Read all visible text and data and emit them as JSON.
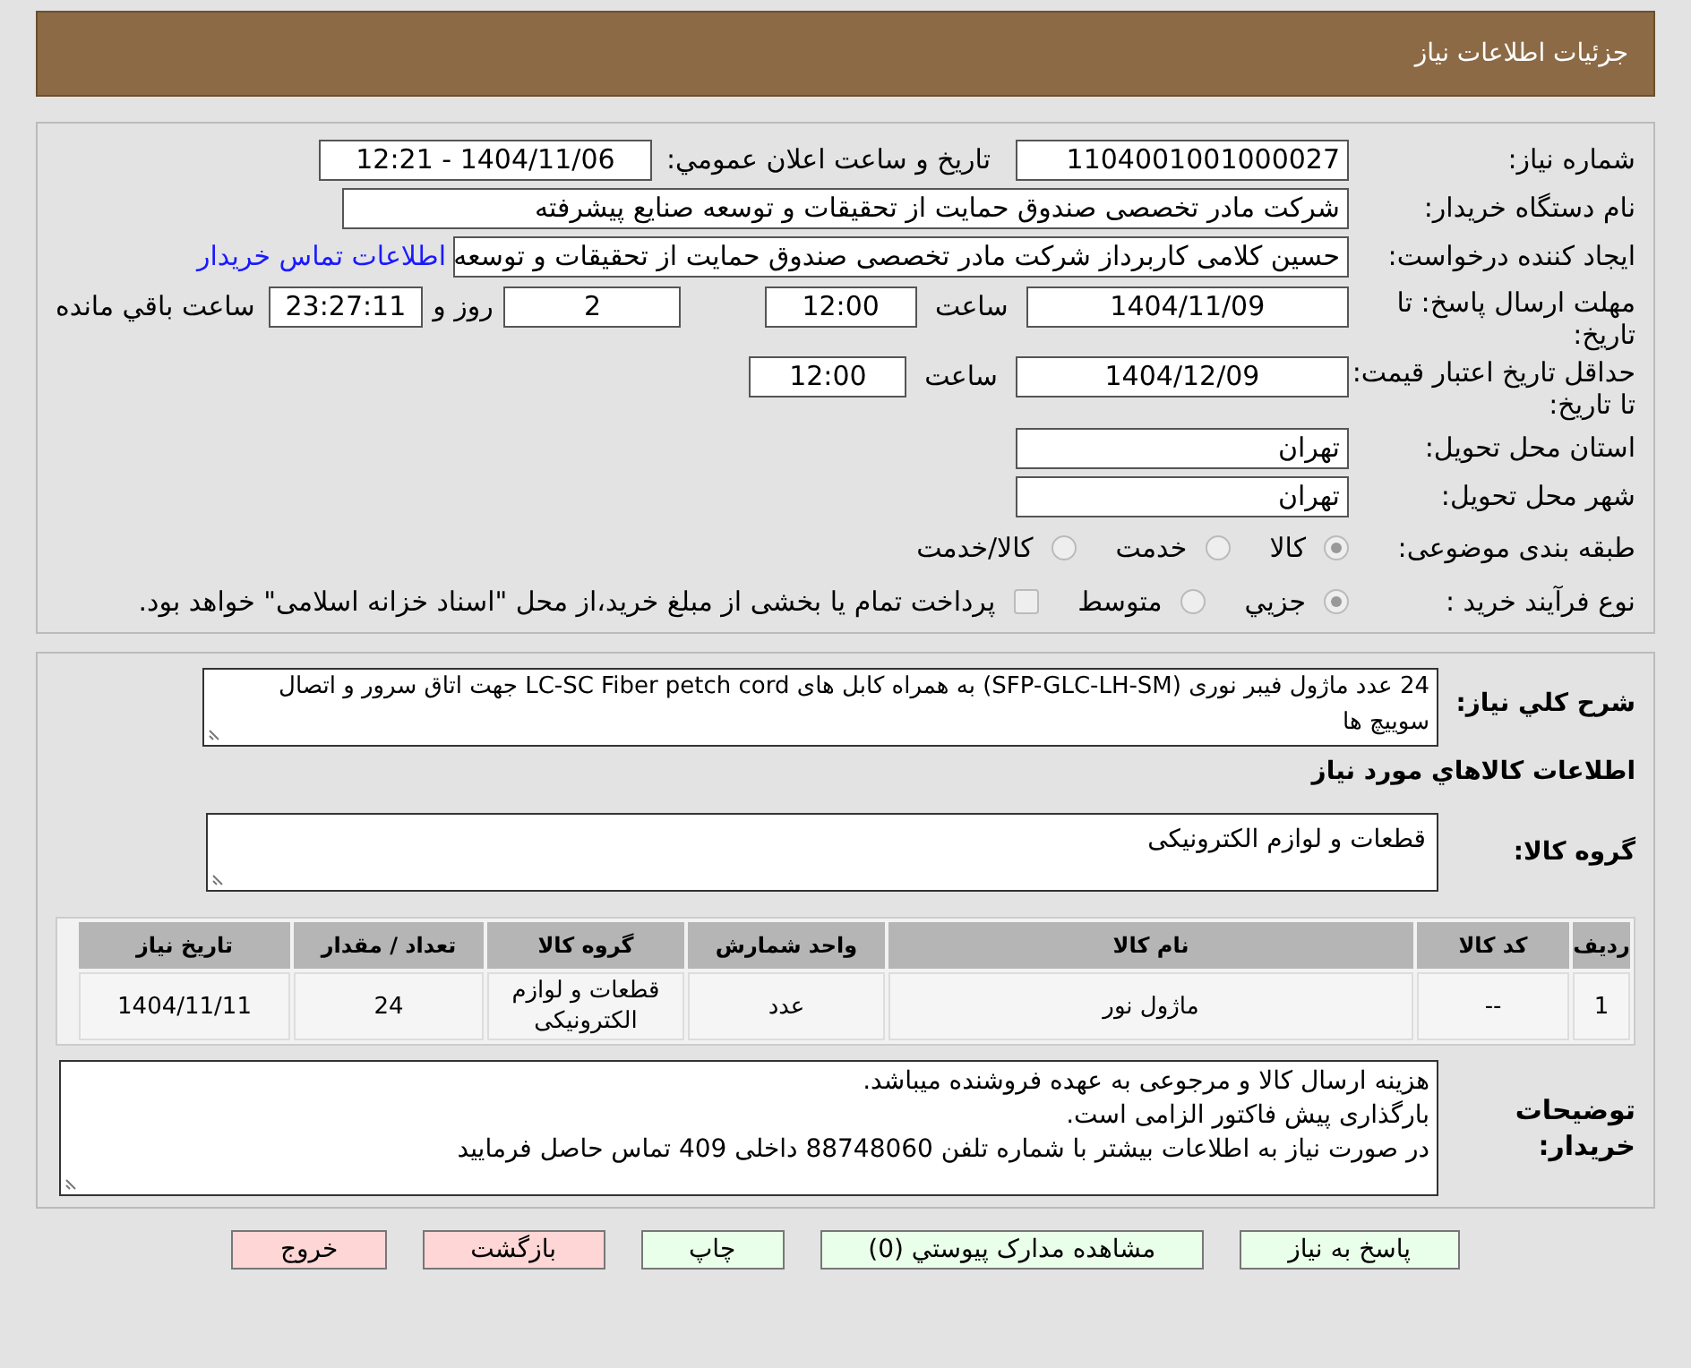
{
  "header": {
    "title": "جزئیات اطلاعات نیاز"
  },
  "need_number": {
    "label": "شماره نیاز:",
    "value": "1104001001000027"
  },
  "announce": {
    "label": "تاریخ و ساعت اعلان عمومي:",
    "value": "1404/11/06 - 12:21"
  },
  "buyer": {
    "label": "نام دستگاه خریدار:",
    "value": "شرکت مادر تخصصی صندوق حمایت از تحقیقات و توسعه صنایع پیشرفته"
  },
  "creator": {
    "label": "ایجاد کننده درخواست:",
    "value": "حسین کلامی کاربرداز شرکت مادر تخصصی صندوق حمایت از تحقیقات و توسعه",
    "link": "اطلاعات تماس خریدار"
  },
  "deadline": {
    "label": "مهلت ارسال پاسخ: تا تاریخ:",
    "date": "1404/11/09",
    "time_label": "ساعت",
    "time": "12:00",
    "days": "2",
    "days_label": "روز و",
    "remaining": "23:27:11",
    "remaining_label": "ساعت باقي مانده"
  },
  "validity": {
    "label": "حداقل تاریخ اعتبار قیمت: تا تاریخ:",
    "date": "1404/12/09",
    "time_label": "ساعت",
    "time": "12:00"
  },
  "province": {
    "label": "استان محل تحویل:",
    "value": "تهران"
  },
  "city": {
    "label": "شهر محل تحویل:",
    "value": "تهران"
  },
  "category": {
    "label": "طبقه بندی موضوعی:",
    "options": [
      {
        "label": "کالا",
        "selected": true
      },
      {
        "label": "خدمت",
        "selected": false
      },
      {
        "label": "کالا/خدمت",
        "selected": false
      }
    ]
  },
  "process": {
    "label": "نوع فرآیند خرید :",
    "options": [
      {
        "label": "جزيي",
        "selected": true
      },
      {
        "label": "متوسط",
        "selected": false
      }
    ],
    "payment": {
      "label": "پرداخت تمام یا بخشی از مبلغ خرید،از محل \"اسناد خزانه اسلامی\" خواهد بود.",
      "checked": false
    }
  },
  "description": {
    "label": "شرح کلي نیاز:",
    "value": "24 عدد ماژول فیبر نوری (SFP-GLC-LH-SM) به همراه کابل های LC-SC   Fiber petch cord جهت اتاق سرور و اتصال سوییچ ها"
  },
  "goods_heading": "اطلاعات کالاهاي مورد نیاز",
  "goods_group": {
    "label": "گروه کالا:",
    "value": "قطعات و لوازم الکترونیکی"
  },
  "table": {
    "columns": [
      "ردیف",
      "کد کالا",
      "نام کالا",
      "واحد شمارش",
      "گروه کالا",
      "تعداد / مقدار",
      "تاریخ نیاز"
    ],
    "rows": [
      [
        "1",
        "--",
        "ماژول نور",
        "عدد",
        "قطعات و لوازم الکترونیکی",
        "24",
        "1404/11/11"
      ]
    ]
  },
  "notes": {
    "label": "توضیحات خریدار:",
    "lines": [
      "هزینه ارسال کالا و مرجوعی به عهده فروشنده میباشد.",
      "بارگذاری پیش فاکتور الزامی است.",
      "در صورت نیاز به اطلاعات بیشتر با شماره تلفن 88748060 داخلی 409 تماس حاصل فرمایید"
    ]
  },
  "buttons": [
    {
      "label": "پاسخ به نیاز",
      "kind": "green"
    },
    {
      "label": "مشاهده مدارک پیوستي (0)",
      "kind": "green"
    },
    {
      "label": "چاپ",
      "kind": "green"
    },
    {
      "label": "بازگشت",
      "kind": "red"
    },
    {
      "label": "خروج",
      "kind": "red"
    }
  ]
}
